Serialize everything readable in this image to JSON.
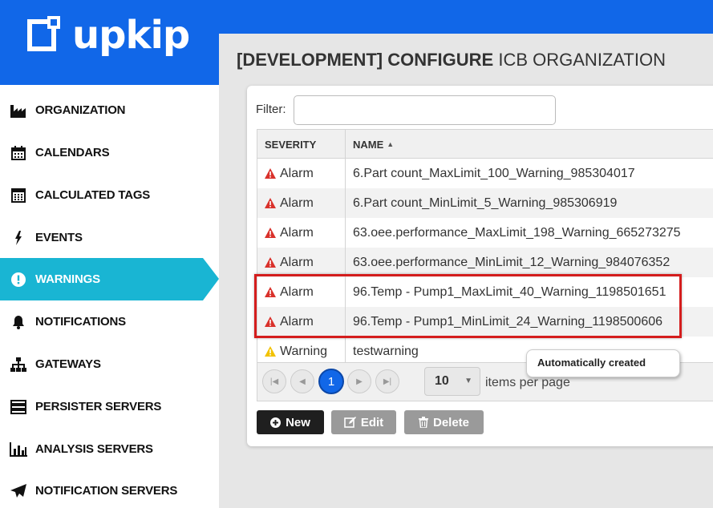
{
  "app": {
    "logo_text": "upkip"
  },
  "sidebar": {
    "items": [
      {
        "label": "ORGANIZATION",
        "icon": "factory-icon",
        "active": false
      },
      {
        "label": "CALENDARS",
        "icon": "calendar-icon",
        "active": false
      },
      {
        "label": "CALCULATED TAGS",
        "icon": "calculator-icon",
        "active": false
      },
      {
        "label": "EVENTS",
        "icon": "bolt-icon",
        "active": false
      },
      {
        "label": "WARNINGS",
        "icon": "exclamation-circle-icon",
        "active": true
      },
      {
        "label": "NOTIFICATIONS",
        "icon": "bell-icon",
        "active": false
      },
      {
        "label": "GATEWAYS",
        "icon": "sitemap-icon",
        "active": false
      },
      {
        "label": "PERSISTER SERVERS",
        "icon": "server-icon",
        "active": false
      },
      {
        "label": "ANALYSIS SERVERS",
        "icon": "bar-chart-icon",
        "active": false
      },
      {
        "label": "NOTIFICATION SERVERS",
        "icon": "paper-plane-icon",
        "active": false
      }
    ]
  },
  "page": {
    "title_bold": "[DEVELOPMENT] CONFIGURE",
    "title_rest": "ICB ORGANIZATION"
  },
  "filter": {
    "label": "Filter:",
    "value": ""
  },
  "grid": {
    "columns": {
      "severity": "SEVERITY",
      "name": "NAME"
    },
    "rows": [
      {
        "severity": "Alarm",
        "level": "alarm",
        "name": "6.Part count_MaxLimit_100_Warning_985304017"
      },
      {
        "severity": "Alarm",
        "level": "alarm",
        "name": "6.Part count_MinLimit_5_Warning_985306919"
      },
      {
        "severity": "Alarm",
        "level": "alarm",
        "name": "63.oee.performance_MaxLimit_198_Warning_665273275"
      },
      {
        "severity": "Alarm",
        "level": "alarm",
        "name": "63.oee.performance_MinLimit_12_Warning_984076352"
      },
      {
        "severity": "Alarm",
        "level": "alarm",
        "name": "96.Temp - Pump1_MaxLimit_40_Warning_1198501651"
      },
      {
        "severity": "Alarm",
        "level": "alarm",
        "name": "96.Temp - Pump1_MinLimit_24_Warning_1198500606"
      },
      {
        "severity": "Warning",
        "level": "warning",
        "name": "testwarning"
      }
    ]
  },
  "pager": {
    "current_page": "1",
    "page_size": "10",
    "label": "items per page"
  },
  "tooltip": {
    "text": "Automatically created"
  },
  "actions": {
    "new": "New",
    "edit": "Edit",
    "delete": "Delete"
  },
  "colors": {
    "brand_blue": "#1167e8",
    "active_cyan": "#19b5d3",
    "alarm_red": "#d9312b",
    "warning_yellow": "#f2c200",
    "highlight_red": "#d41d1d"
  }
}
